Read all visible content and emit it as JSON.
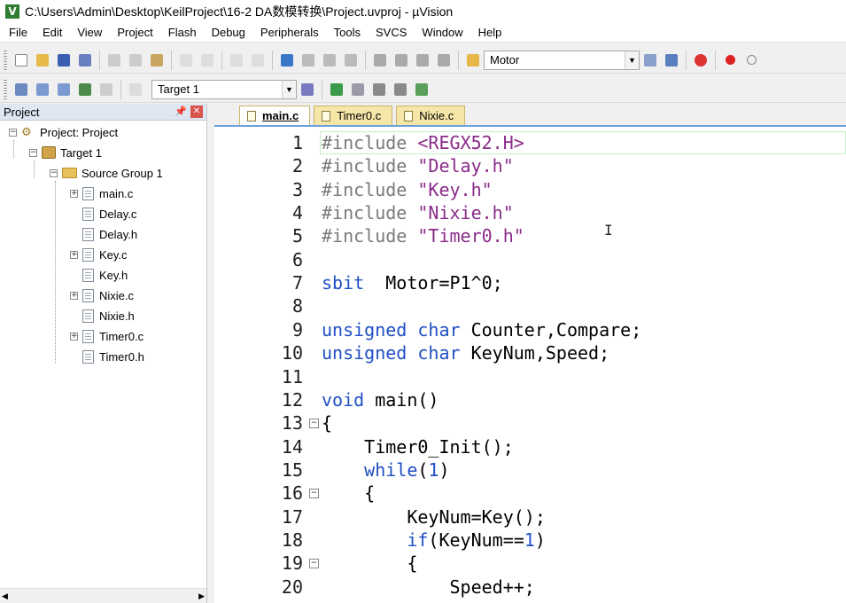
{
  "window": {
    "title": "C:\\Users\\Admin\\Desktop\\KeilProject\\16-2 DA数模转换\\Project.uvproj - µVision",
    "icon": "uvision-app-icon"
  },
  "menu": [
    "File",
    "Edit",
    "View",
    "Project",
    "Flash",
    "Debug",
    "Peripherals",
    "Tools",
    "SVCS",
    "Window",
    "Help"
  ],
  "toolbar1": {
    "target_combo": "Motor"
  },
  "toolbar2": {
    "target_select": "Target 1"
  },
  "project_panel": {
    "title": "Project",
    "pin_icon": "pin-icon",
    "close_icon": "close-icon",
    "tree": [
      {
        "label": "Project: Project",
        "depth": 0,
        "type": "project",
        "expander": "⊟"
      },
      {
        "label": "Target 1",
        "depth": 1,
        "type": "target",
        "expander": "⊟"
      },
      {
        "label": "Source Group 1",
        "depth": 2,
        "type": "folder",
        "expander": "⊟"
      },
      {
        "label": "main.c",
        "depth": 3,
        "type": "file",
        "expander": "⊞"
      },
      {
        "label": "Delay.c",
        "depth": 3,
        "type": "file",
        "expander": ""
      },
      {
        "label": "Delay.h",
        "depth": 3,
        "type": "file",
        "expander": ""
      },
      {
        "label": "Key.c",
        "depth": 3,
        "type": "file",
        "expander": "⊞"
      },
      {
        "label": "Key.h",
        "depth": 3,
        "type": "file",
        "expander": ""
      },
      {
        "label": "Nixie.c",
        "depth": 3,
        "type": "file",
        "expander": "⊞"
      },
      {
        "label": "Nixie.h",
        "depth": 3,
        "type": "file",
        "expander": ""
      },
      {
        "label": "Timer0.c",
        "depth": 3,
        "type": "file",
        "expander": "⊞"
      },
      {
        "label": "Timer0.h",
        "depth": 3,
        "type": "file",
        "expander": ""
      }
    ]
  },
  "editor": {
    "tabs": [
      {
        "label": "main.c",
        "active": true
      },
      {
        "label": "Timer0.c",
        "active": false
      },
      {
        "label": "Nixie.c",
        "active": false
      }
    ],
    "lines": [
      {
        "n": "1",
        "fold": "",
        "tokens": [
          [
            "pp",
            "#include "
          ],
          [
            "ppv",
            "<REGX52.H>"
          ]
        ]
      },
      {
        "n": "2",
        "fold": "",
        "tokens": [
          [
            "pp",
            "#include "
          ],
          [
            "ppv",
            "\"Delay.h\""
          ]
        ]
      },
      {
        "n": "3",
        "fold": "",
        "tokens": [
          [
            "pp",
            "#include "
          ],
          [
            "ppv",
            "\"Key.h\""
          ]
        ]
      },
      {
        "n": "4",
        "fold": "",
        "tokens": [
          [
            "pp",
            "#include "
          ],
          [
            "ppv",
            "\"Nixie.h\""
          ]
        ]
      },
      {
        "n": "5",
        "fold": "",
        "tokens": [
          [
            "pp",
            "#include "
          ],
          [
            "ppv",
            "\"Timer0.h\""
          ]
        ]
      },
      {
        "n": "6",
        "fold": "",
        "tokens": []
      },
      {
        "n": "7",
        "fold": "",
        "tokens": [
          [
            "kw",
            "sbit"
          ],
          [
            "",
            "  Motor=P1^0;"
          ]
        ]
      },
      {
        "n": "8",
        "fold": "",
        "tokens": []
      },
      {
        "n": "9",
        "fold": "",
        "tokens": [
          [
            "kw",
            "unsigned char"
          ],
          [
            "",
            " Counter,Compare;"
          ]
        ]
      },
      {
        "n": "10",
        "fold": "",
        "tokens": [
          [
            "kw",
            "unsigned char"
          ],
          [
            "",
            " KeyNum,Speed;"
          ]
        ]
      },
      {
        "n": "11",
        "fold": "",
        "tokens": []
      },
      {
        "n": "12",
        "fold": "",
        "tokens": [
          [
            "kw",
            "void"
          ],
          [
            "",
            " main()"
          ]
        ]
      },
      {
        "n": "13",
        "fold": "⊟",
        "tokens": [
          [
            "",
            "{"
          ]
        ]
      },
      {
        "n": "14",
        "fold": "",
        "tokens": [
          [
            "",
            "    Timer0_Init();"
          ]
        ]
      },
      {
        "n": "15",
        "fold": "",
        "tokens": [
          [
            "",
            "    "
          ],
          [
            "kw",
            "while"
          ],
          [
            "",
            "("
          ],
          [
            "num",
            "1"
          ],
          [
            "",
            ")"
          ]
        ]
      },
      {
        "n": "16",
        "fold": "⊟",
        "tokens": [
          [
            "",
            "    {"
          ]
        ]
      },
      {
        "n": "17",
        "fold": "",
        "tokens": [
          [
            "",
            "        KeyNum=Key();"
          ]
        ]
      },
      {
        "n": "18",
        "fold": "",
        "tokens": [
          [
            "",
            "        "
          ],
          [
            "kw",
            "if"
          ],
          [
            "",
            "(KeyNum=="
          ],
          [
            "num",
            "1"
          ],
          [
            "",
            ")"
          ]
        ]
      },
      {
        "n": "19",
        "fold": "⊟",
        "tokens": [
          [
            "",
            "        {"
          ]
        ]
      },
      {
        "n": "20",
        "fold": "",
        "tokens": [
          [
            "",
            "            Speed++;"
          ]
        ]
      }
    ]
  }
}
